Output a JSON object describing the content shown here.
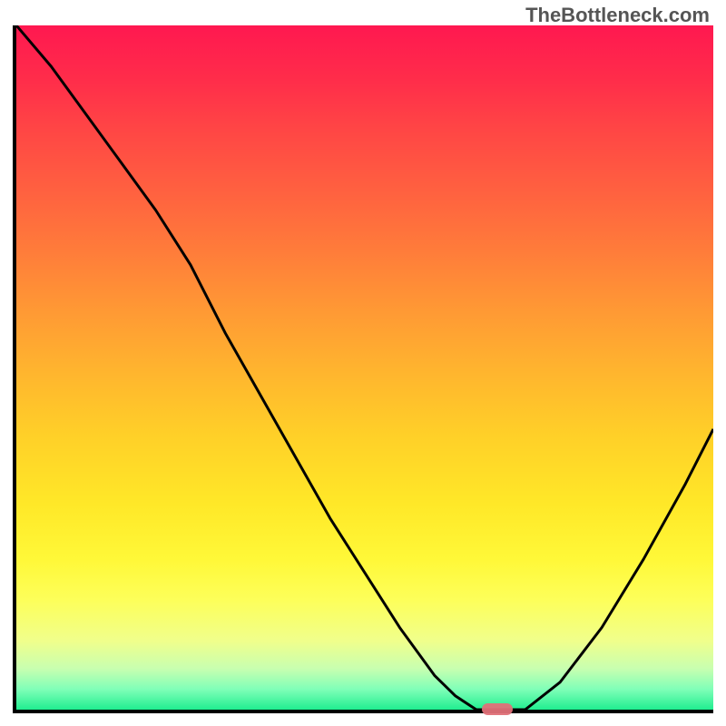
{
  "watermark": "TheBottleneck.com",
  "chart_data": {
    "type": "line",
    "title": "",
    "xlabel": "",
    "ylabel": "",
    "xlim": [
      0,
      100
    ],
    "ylim": [
      0,
      100
    ],
    "description": "Bottleneck curve showing optimal configuration point. Background gradient from red (high bottleneck) at top through orange, yellow to green (no bottleneck) at bottom. Black curve descends from top-left, reaches minimum near x=70, then rises toward top-right. Small red marker indicates optimal point near bottom.",
    "series": [
      {
        "name": "bottleneck-curve",
        "x": [
          0,
          5,
          10,
          15,
          20,
          25,
          30,
          35,
          40,
          45,
          50,
          55,
          60,
          63,
          66,
          70,
          73,
          78,
          84,
          90,
          96,
          100
        ],
        "y": [
          100,
          94,
          87,
          80,
          73,
          65,
          55,
          46,
          37,
          28,
          20,
          12,
          5,
          2,
          0,
          0,
          0,
          4,
          12,
          22,
          33,
          41
        ]
      }
    ],
    "optimal_marker": {
      "x": 69,
      "width_pct": 4.4
    },
    "gradient_stops": [
      {
        "pos": 0,
        "color": "#ff1850"
      },
      {
        "pos": 50,
        "color": "#ffc028"
      },
      {
        "pos": 85,
        "color": "#fdff5a"
      },
      {
        "pos": 100,
        "color": "#20ee90"
      }
    ]
  }
}
